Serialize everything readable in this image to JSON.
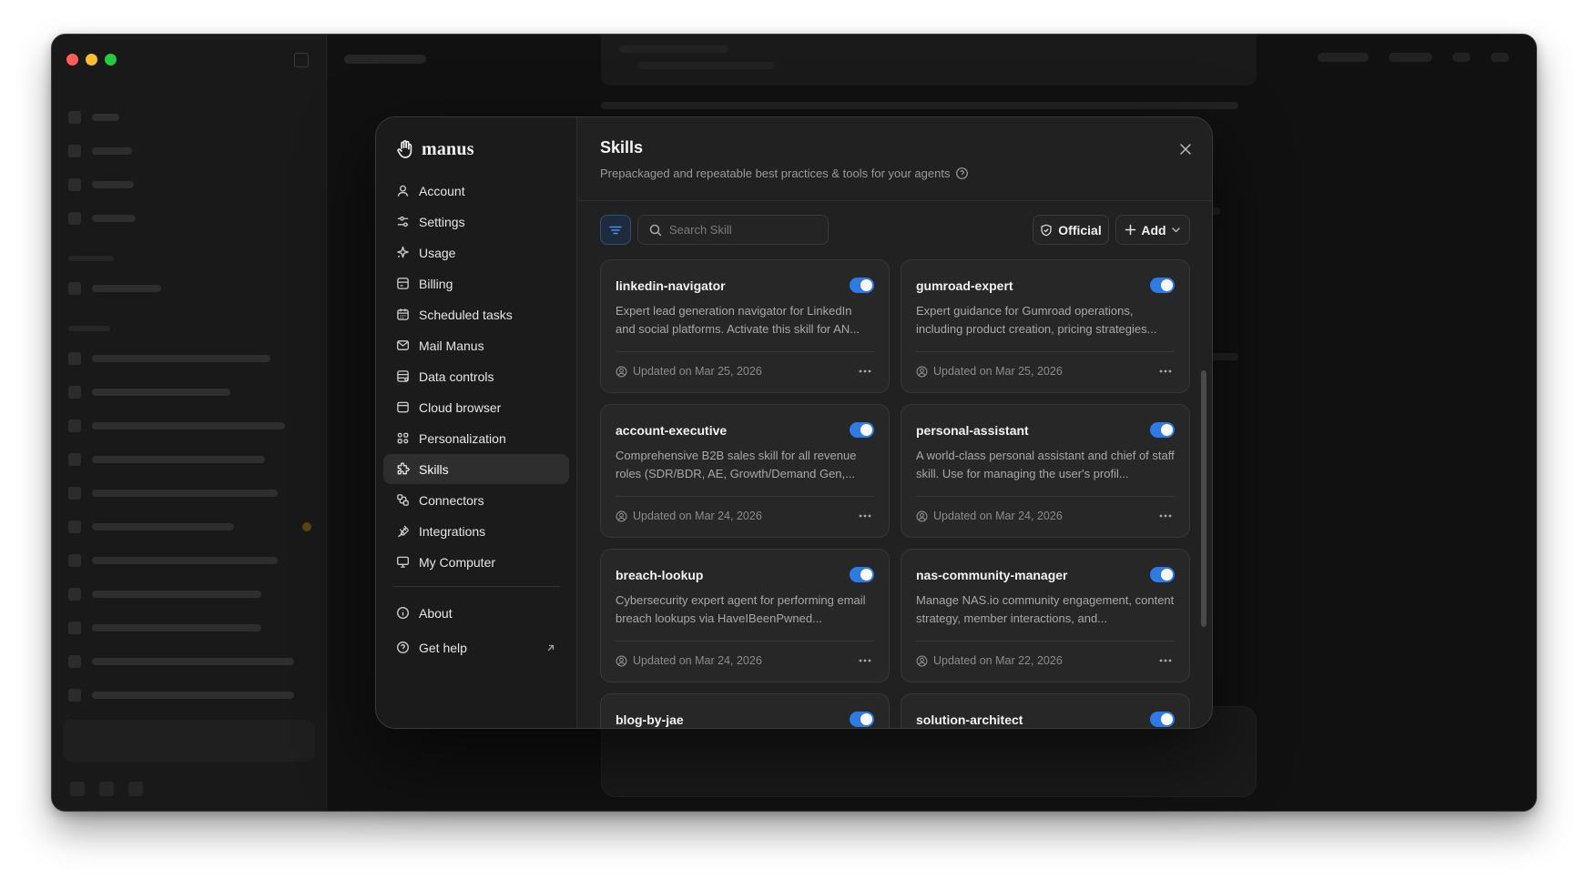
{
  "brand": {
    "name": "manus"
  },
  "settings_nav": [
    {
      "label": "Account",
      "icon": "user-icon"
    },
    {
      "label": "Settings",
      "icon": "sliders-icon"
    },
    {
      "label": "Usage",
      "icon": "sparkle-icon"
    },
    {
      "label": "Billing",
      "icon": "billing-icon"
    },
    {
      "label": "Scheduled tasks",
      "icon": "calendar-icon"
    },
    {
      "label": "Mail Manus",
      "icon": "mail-icon"
    },
    {
      "label": "Data controls",
      "icon": "database-icon"
    },
    {
      "label": "Cloud browser",
      "icon": "browser-icon"
    },
    {
      "label": "Personalization",
      "icon": "grid-icon"
    },
    {
      "label": "Skills",
      "icon": "puzzle-icon",
      "active": true
    },
    {
      "label": "Connectors",
      "icon": "connectors-icon"
    },
    {
      "label": "Integrations",
      "icon": "plug-icon"
    },
    {
      "label": "My Computer",
      "icon": "monitor-icon"
    }
  ],
  "settings_footer": [
    {
      "label": "About",
      "icon": "info-icon"
    },
    {
      "label": "Get help",
      "icon": "help-icon"
    }
  ],
  "page": {
    "title": "Skills",
    "subtitle": "Prepackaged and repeatable best practices & tools for your agents"
  },
  "toolbar": {
    "search_placeholder": "Search Skill",
    "official_label": "Official",
    "add_label": "Add"
  },
  "skills": [
    {
      "name": "linkedin-navigator",
      "description": "Expert lead generation navigator for LinkedIn and social platforms. Activate this skill for AN...",
      "updated": "Updated on Mar 25, 2026",
      "enabled": true
    },
    {
      "name": "gumroad-expert",
      "description": "Expert guidance for Gumroad operations, including product creation, pricing strategies...",
      "updated": "Updated on Mar 25, 2026",
      "enabled": true
    },
    {
      "name": "account-executive",
      "description": "Comprehensive B2B sales skill for all revenue roles (SDR/BDR, AE, Growth/Demand Gen,...",
      "updated": "Updated on Mar 24, 2026",
      "enabled": true
    },
    {
      "name": "personal-assistant",
      "description": "A world-class personal assistant and chief of staff skill. Use for managing the user's profil...",
      "updated": "Updated on Mar 24, 2026",
      "enabled": true
    },
    {
      "name": "breach-lookup",
      "description": "Cybersecurity expert agent for performing email breach lookups via HaveIBeenPwned...",
      "updated": "Updated on Mar 24, 2026",
      "enabled": true
    },
    {
      "name": "nas-community-manager",
      "description": "Manage NAS.io community engagement, content strategy, member interactions, and...",
      "updated": "Updated on Mar 22, 2026",
      "enabled": true
    },
    {
      "name": "blog-by-jae",
      "description": "",
      "updated": "",
      "enabled": true
    },
    {
      "name": "solution-architect",
      "description": "",
      "updated": "",
      "enabled": true
    }
  ],
  "colors": {
    "accent": "#2f7ae5",
    "modal_bg": "#212121",
    "sidebar_bg": "#1b1b1b",
    "card_bg": "#272727"
  }
}
